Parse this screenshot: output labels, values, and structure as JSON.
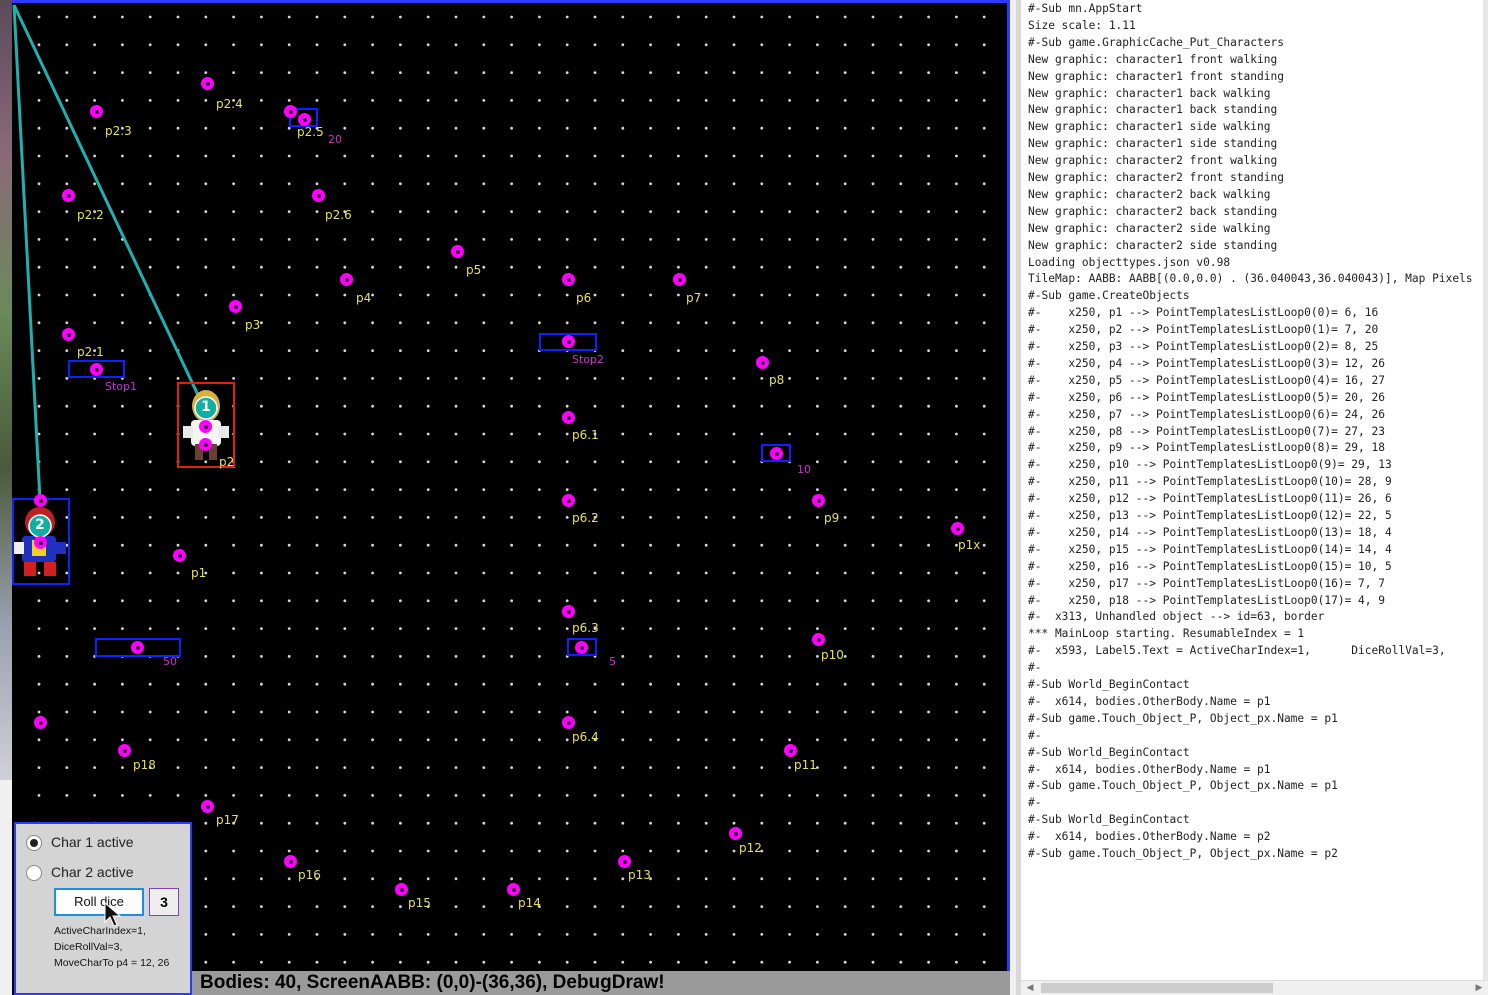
{
  "points": [
    {
      "label": "p2.4"
    },
    {
      "label": "p2.3"
    },
    {
      "label": "p2.5"
    },
    {
      "label": "p2.2"
    },
    {
      "label": "p2.6"
    },
    {
      "label": "p5"
    },
    {
      "label": "p4"
    },
    {
      "label": "p6"
    },
    {
      "label": "p7"
    },
    {
      "label": "p3"
    },
    {
      "label": "p2.1"
    },
    {
      "label": "p8"
    },
    {
      "label": "p6.1"
    },
    {
      "label": "p6.2"
    },
    {
      "label": "p9"
    },
    {
      "label": "p1x"
    },
    {
      "label": "p1"
    },
    {
      "label": "p6.3"
    },
    {
      "label": "p10"
    },
    {
      "label": "p6.4"
    },
    {
      "label": "p18"
    },
    {
      "label": "p11"
    },
    {
      "label": "p17"
    },
    {
      "label": "p12"
    },
    {
      "label": "p16"
    },
    {
      "label": "p13"
    },
    {
      "label": "p15"
    },
    {
      "label": "p14"
    },
    {
      "label": ""
    },
    {
      "label": ""
    },
    {
      "label": ""
    },
    {
      "label": ""
    }
  ],
  "markers": {
    "m20": "20",
    "stop1": "Stop1",
    "stop2": "Stop2",
    "m10": "10",
    "m50": "50",
    "m5": "5"
  },
  "characters": {
    "char1_badge": "1",
    "char2_badge": "2",
    "char1_label": "p2"
  },
  "status_bar": "Bodies: 40, ScreenAABB: (0,0)-(36,36), DebugDraw!",
  "panel": {
    "radio1": "Char 1 active",
    "radio1_checked": true,
    "radio2": "Char 2 active",
    "radio2_checked": false,
    "roll_button": "Roll dice",
    "dice_value": "3",
    "info_lines": [
      "ActiveCharIndex=1,",
      "DiceRollVal=3,",
      "MoveCharTo p4  = 12, 26"
    ]
  },
  "console_lines": [
    "#-Sub mn.AppStart",
    "Size scale: 1.11",
    "#-Sub game.GraphicCache_Put_Characters",
    "New graphic: character1 front walking",
    "New graphic: character1 front standing",
    "New graphic: character1 back walking",
    "New graphic: character1 back standing",
    "New graphic: character1 side walking",
    "New graphic: character1 side standing",
    "New graphic: character2 front walking",
    "New graphic: character2 front standing",
    "New graphic: character2 back walking",
    "New graphic: character2 back standing",
    "New graphic: character2 side walking",
    "New graphic: character2 side standing",
    "Loading objecttypes.json v0.98",
    "TileMap: AABB: AABB[(0.0,0.0) . (36.040043,36.040043)], Map Pixels",
    "#-Sub game.CreateObjects",
    "#-    x250, p1 --> PointTemplatesListLoop0(0)= 6, 16",
    "#-    x250, p2 --> PointTemplatesListLoop0(1)= 7, 20",
    "#-    x250, p3 --> PointTemplatesListLoop0(2)= 8, 25",
    "#-    x250, p4 --> PointTemplatesListLoop0(3)= 12, 26",
    "#-    x250, p5 --> PointTemplatesListLoop0(4)= 16, 27",
    "#-    x250, p6 --> PointTemplatesListLoop0(5)= 20, 26",
    "#-    x250, p7 --> PointTemplatesListLoop0(6)= 24, 26",
    "#-    x250, p8 --> PointTemplatesListLoop0(7)= 27, 23",
    "#-    x250, p9 --> PointTemplatesListLoop0(8)= 29, 18",
    "#-    x250, p10 --> PointTemplatesListLoop0(9)= 29, 13",
    "#-    x250, p11 --> PointTemplatesListLoop0(10)= 28, 9",
    "#-    x250, p12 --> PointTemplatesListLoop0(11)= 26, 6",
    "#-    x250, p13 --> PointTemplatesListLoop0(12)= 22, 5",
    "#-    x250, p14 --> PointTemplatesListLoop0(13)= 18, 4",
    "#-    x250, p15 --> PointTemplatesListLoop0(14)= 14, 4",
    "#-    x250, p16 --> PointTemplatesListLoop0(15)= 10, 5",
    "#-    x250, p17 --> PointTemplatesListLoop0(16)= 7, 7",
    "#-    x250, p18 --> PointTemplatesListLoop0(17)= 4, 9",
    "#-  x313, Unhandled object --> id=63, border",
    "*** MainLoop starting. ResumableIndex = 1",
    "#-  x593, Label5.Text = ActiveCharIndex=1,      DiceRollVal=3,",
    "#-",
    "#-Sub World_BeginContact",
    "#-  x614, bodies.OtherBody.Name = p1",
    "#-Sub game.Touch_Object_P, Object_px.Name = p1",
    "#-",
    "#-Sub World_BeginContact",
    "#-  x614, bodies.OtherBody.Name = p1",
    "#-Sub game.Touch_Object_P, Object_px.Name = p1",
    "#-",
    "#-Sub World_BeginContact",
    "#-  x614, bodies.OtherBody.Name = p2",
    "#-Sub game.Touch_Object_P, Object_px.Name = p2"
  ],
  "colors": {
    "point": "#ff00ff",
    "label": "#e8e060",
    "box": "#1020ff",
    "line": "#20b0b0",
    "char1_frame": "#e02010"
  }
}
